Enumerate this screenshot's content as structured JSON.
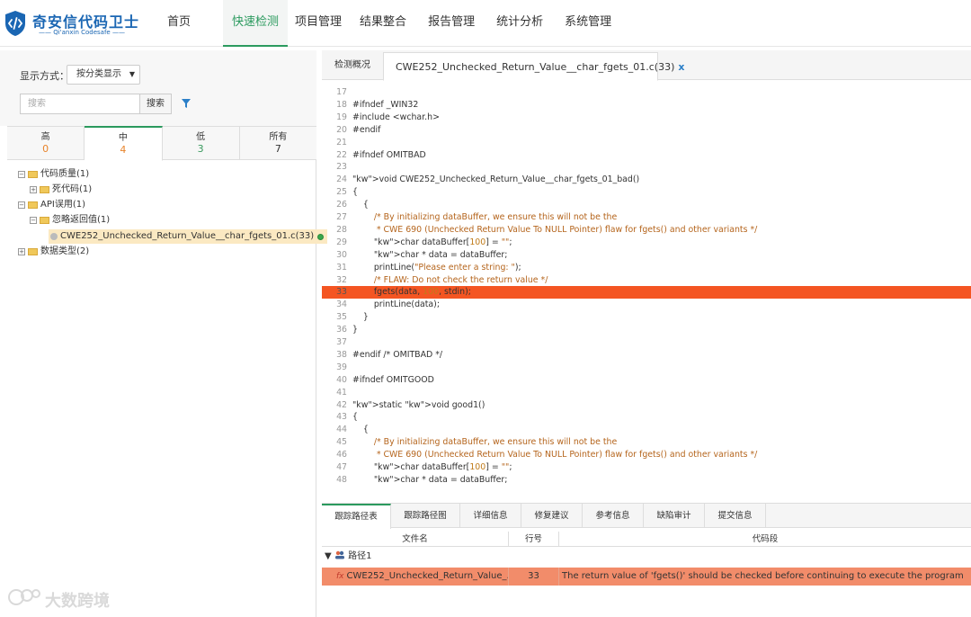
{
  "brand": {
    "name": "奇安信代码卫士",
    "sub": "—— Qi'anxin Codesafe ——",
    "color": "#1a66b3"
  },
  "nav": [
    {
      "label": "首页",
      "active": false
    },
    {
      "label": "快速检测",
      "active": true
    },
    {
      "label": "项目管理",
      "active": false
    },
    {
      "label": "结果整合",
      "active": false
    },
    {
      "label": "报告管理",
      "active": false
    },
    {
      "label": "统计分析",
      "active": false
    },
    {
      "label": "系统管理",
      "active": false
    }
  ],
  "left": {
    "display_label": "显示方式：",
    "display_value": "按分类显示",
    "search_placeholder": "搜索",
    "search_button": "搜索",
    "severity": [
      {
        "name": "高",
        "count": "0",
        "color": "#e8832a"
      },
      {
        "name": "中",
        "count": "4",
        "color": "#e8832a"
      },
      {
        "name": "低",
        "count": "3",
        "color": "#3a9a5e"
      },
      {
        "name": "所有",
        "count": "7",
        "color": "#333333"
      }
    ],
    "tree": [
      {
        "label": "代码质量(1)",
        "toggle": "−"
      },
      {
        "label": "死代码(1)",
        "toggle": "+"
      },
      {
        "label": "API误用(1)",
        "toggle": "−"
      },
      {
        "label": "忽略返回值(1)",
        "toggle": "−"
      },
      {
        "label": "CWE252_Unchecked_Return_Value__char_fgets_01.c(33)"
      },
      {
        "label": "数据类型(2)",
        "toggle": "+"
      }
    ]
  },
  "tabs": {
    "overview": "检测概况",
    "file": "CWE252_Unchecked_Return_Value__char_fgets_01.c(33)",
    "close": "x"
  },
  "code": {
    "highlight_line": "33",
    "lines": [
      {
        "n": "17",
        "t": ""
      },
      {
        "n": "18",
        "t": "#ifndef _WIN32"
      },
      {
        "n": "19",
        "t": "#include <wchar.h>"
      },
      {
        "n": "20",
        "t": "#endif"
      },
      {
        "n": "21",
        "t": ""
      },
      {
        "n": "22",
        "t": "#ifndef OMITBAD"
      },
      {
        "n": "23",
        "t": ""
      },
      {
        "n": "24",
        "t": "void CWE252_Unchecked_Return_Value__char_fgets_01_bad()"
      },
      {
        "n": "25",
        "t": "{"
      },
      {
        "n": "26",
        "t": "    {"
      },
      {
        "n": "27",
        "t": "        /* By initializing dataBuffer, we ensure this will not be the"
      },
      {
        "n": "28",
        "t": "         * CWE 690 (Unchecked Return Value To NULL Pointer) flaw for fgets() and other variants */"
      },
      {
        "n": "29",
        "t": "        char dataBuffer[100] = \"\";"
      },
      {
        "n": "30",
        "t": "        char * data = dataBuffer;"
      },
      {
        "n": "31",
        "t": "        printLine(\"Please enter a string: \");"
      },
      {
        "n": "32",
        "t": "        /* FLAW: Do not check the return value */"
      },
      {
        "n": "33",
        "t": "        fgets(data, 100, stdin);"
      },
      {
        "n": "34",
        "t": "        printLine(data);"
      },
      {
        "n": "35",
        "t": "    }"
      },
      {
        "n": "36",
        "t": "}"
      },
      {
        "n": "37",
        "t": ""
      },
      {
        "n": "38",
        "t": "#endif /* OMITBAD */"
      },
      {
        "n": "39",
        "t": ""
      },
      {
        "n": "40",
        "t": "#ifndef OMITGOOD"
      },
      {
        "n": "41",
        "t": ""
      },
      {
        "n": "42",
        "t": "static void good1()"
      },
      {
        "n": "43",
        "t": "{"
      },
      {
        "n": "44",
        "t": "    {"
      },
      {
        "n": "45",
        "t": "        /* By initializing dataBuffer, we ensure this will not be the"
      },
      {
        "n": "46",
        "t": "         * CWE 690 (Unchecked Return Value To NULL Pointer) flaw for fgets() and other variants */"
      },
      {
        "n": "47",
        "t": "        char dataBuffer[100] = \"\";"
      },
      {
        "n": "48",
        "t": "        char * data = dataBuffer;"
      }
    ]
  },
  "bottom": {
    "tabs": [
      "跟踪路径表",
      "跟踪路径图",
      "详细信息",
      "修复建议",
      "参考信息",
      "缺陷审计",
      "提交信息"
    ],
    "columns": [
      "文件名",
      "行号",
      "代码段"
    ],
    "group": "路径1",
    "row": {
      "file": "CWE252_Unchecked_Return_Value_...",
      "line": "33",
      "snippet": "The return value of 'fgets()' should be checked before continuing to execute the program"
    }
  },
  "watermark": "大数跨境"
}
